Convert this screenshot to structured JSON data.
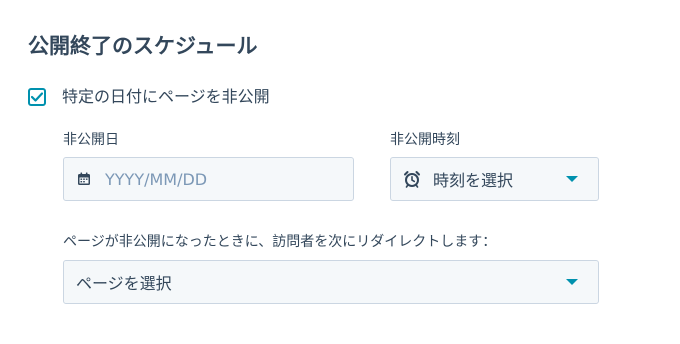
{
  "section": {
    "title": "公開終了のスケジュール"
  },
  "unpublish_checkbox": {
    "label": "特定の日付にページを非公開",
    "checked": true
  },
  "date_field": {
    "label": "非公開日",
    "placeholder": "YYYY/MM/DD",
    "icon": "calendar-icon"
  },
  "time_field": {
    "label": "非公開時刻",
    "selected": "時刻を選択",
    "icon": "alarm-clock-icon"
  },
  "redirect_field": {
    "label": "ページが非公開になったときに、訪問者を次にリダイレクトします：",
    "selected": "ページを選択"
  },
  "colors": {
    "accent": "#0091ae",
    "text": "#33475b",
    "placeholder": "#7c98b6",
    "input_bg": "#f5f8fa",
    "input_border": "#cbd6e2"
  }
}
